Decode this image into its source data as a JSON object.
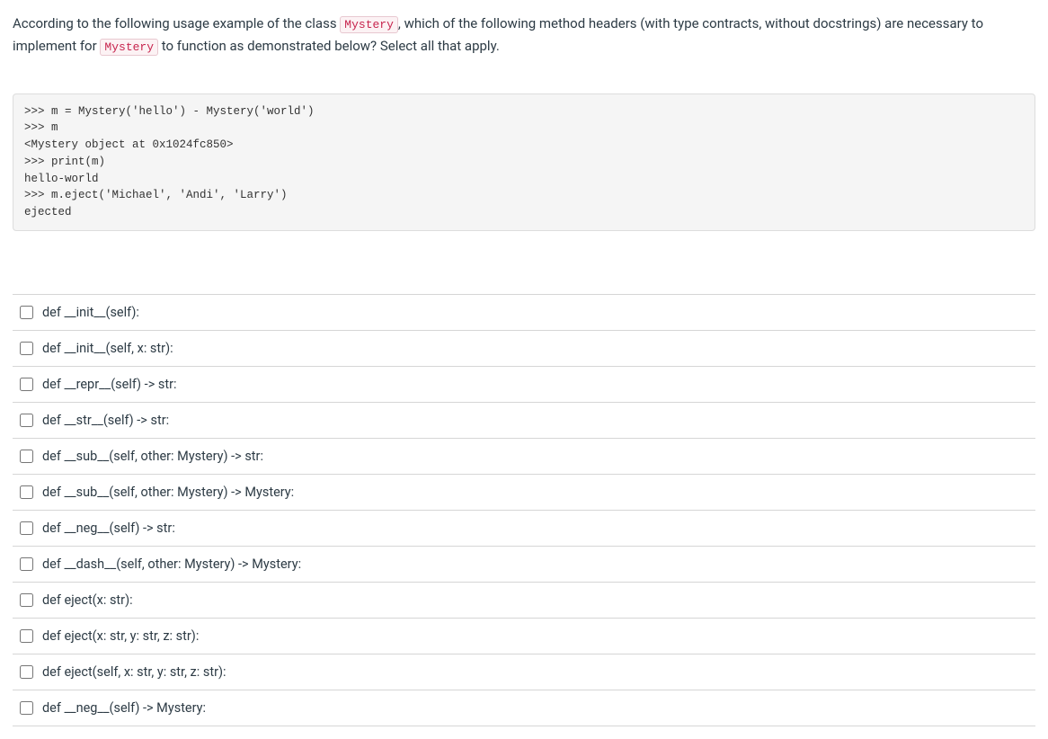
{
  "question": {
    "part1": "According to the following usage example of the class ",
    "code1": "Mystery",
    "part2": ", which of the following method headers (with type contracts, without docstrings) are necessary to implement for ",
    "code2": "Mystery",
    "part3": " to function as demonstrated below? Select all that apply."
  },
  "codeblock": ">>> m = Mystery('hello') - Mystery('world')\n>>> m\n<Mystery object at 0x1024fc850>\n>>> print(m)\nhello-world\n>>> m.eject('Michael', 'Andi', 'Larry')\nejected",
  "options": [
    {
      "label": "def __init__(self):"
    },
    {
      "label": "def __init__(self, x: str):"
    },
    {
      "label": "def __repr__(self) -> str:"
    },
    {
      "label": "def __str__(self) -> str:"
    },
    {
      "label": "def __sub__(self, other: Mystery) -> str:"
    },
    {
      "label": "def __sub__(self, other: Mystery) -> Mystery:"
    },
    {
      "label": "def __neg__(self) -> str:"
    },
    {
      "label": "def __dash__(self, other: Mystery) -> Mystery:"
    },
    {
      "label": "def eject(x: str):"
    },
    {
      "label": "def eject(x: str, y: str, z: str):"
    },
    {
      "label": "def eject(self, x: str, y: str, z: str):"
    },
    {
      "label": "def __neg__(self) -> Mystery:"
    }
  ]
}
